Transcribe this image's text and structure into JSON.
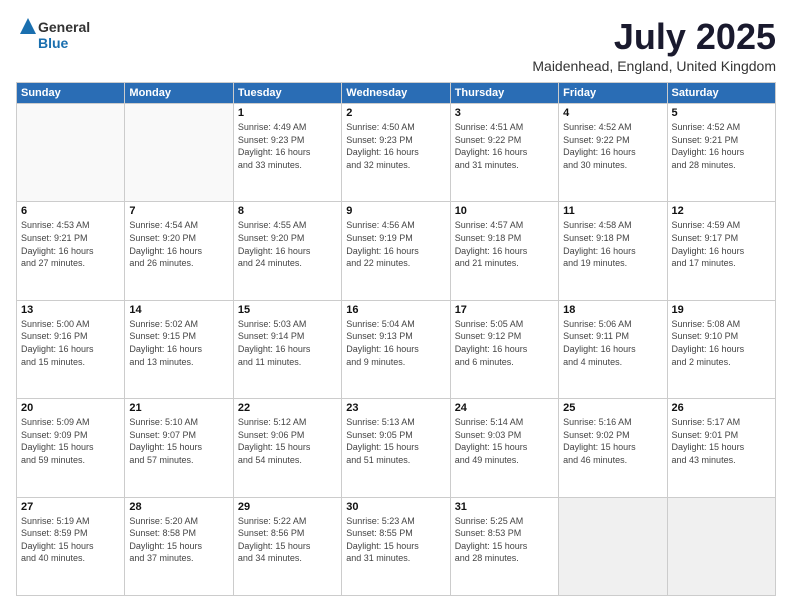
{
  "header": {
    "logo_general": "General",
    "logo_blue": "Blue",
    "month_title": "July 2025",
    "location": "Maidenhead, England, United Kingdom"
  },
  "days_of_week": [
    "Sunday",
    "Monday",
    "Tuesday",
    "Wednesday",
    "Thursday",
    "Friday",
    "Saturday"
  ],
  "weeks": [
    [
      {
        "day": "",
        "info": ""
      },
      {
        "day": "",
        "info": ""
      },
      {
        "day": "1",
        "info": "Sunrise: 4:49 AM\nSunset: 9:23 PM\nDaylight: 16 hours\nand 33 minutes."
      },
      {
        "day": "2",
        "info": "Sunrise: 4:50 AM\nSunset: 9:23 PM\nDaylight: 16 hours\nand 32 minutes."
      },
      {
        "day": "3",
        "info": "Sunrise: 4:51 AM\nSunset: 9:22 PM\nDaylight: 16 hours\nand 31 minutes."
      },
      {
        "day": "4",
        "info": "Sunrise: 4:52 AM\nSunset: 9:22 PM\nDaylight: 16 hours\nand 30 minutes."
      },
      {
        "day": "5",
        "info": "Sunrise: 4:52 AM\nSunset: 9:21 PM\nDaylight: 16 hours\nand 28 minutes."
      }
    ],
    [
      {
        "day": "6",
        "info": "Sunrise: 4:53 AM\nSunset: 9:21 PM\nDaylight: 16 hours\nand 27 minutes."
      },
      {
        "day": "7",
        "info": "Sunrise: 4:54 AM\nSunset: 9:20 PM\nDaylight: 16 hours\nand 26 minutes."
      },
      {
        "day": "8",
        "info": "Sunrise: 4:55 AM\nSunset: 9:20 PM\nDaylight: 16 hours\nand 24 minutes."
      },
      {
        "day": "9",
        "info": "Sunrise: 4:56 AM\nSunset: 9:19 PM\nDaylight: 16 hours\nand 22 minutes."
      },
      {
        "day": "10",
        "info": "Sunrise: 4:57 AM\nSunset: 9:18 PM\nDaylight: 16 hours\nand 21 minutes."
      },
      {
        "day": "11",
        "info": "Sunrise: 4:58 AM\nSunset: 9:18 PM\nDaylight: 16 hours\nand 19 minutes."
      },
      {
        "day": "12",
        "info": "Sunrise: 4:59 AM\nSunset: 9:17 PM\nDaylight: 16 hours\nand 17 minutes."
      }
    ],
    [
      {
        "day": "13",
        "info": "Sunrise: 5:00 AM\nSunset: 9:16 PM\nDaylight: 16 hours\nand 15 minutes."
      },
      {
        "day": "14",
        "info": "Sunrise: 5:02 AM\nSunset: 9:15 PM\nDaylight: 16 hours\nand 13 minutes."
      },
      {
        "day": "15",
        "info": "Sunrise: 5:03 AM\nSunset: 9:14 PM\nDaylight: 16 hours\nand 11 minutes."
      },
      {
        "day": "16",
        "info": "Sunrise: 5:04 AM\nSunset: 9:13 PM\nDaylight: 16 hours\nand 9 minutes."
      },
      {
        "day": "17",
        "info": "Sunrise: 5:05 AM\nSunset: 9:12 PM\nDaylight: 16 hours\nand 6 minutes."
      },
      {
        "day": "18",
        "info": "Sunrise: 5:06 AM\nSunset: 9:11 PM\nDaylight: 16 hours\nand 4 minutes."
      },
      {
        "day": "19",
        "info": "Sunrise: 5:08 AM\nSunset: 9:10 PM\nDaylight: 16 hours\nand 2 minutes."
      }
    ],
    [
      {
        "day": "20",
        "info": "Sunrise: 5:09 AM\nSunset: 9:09 PM\nDaylight: 15 hours\nand 59 minutes."
      },
      {
        "day": "21",
        "info": "Sunrise: 5:10 AM\nSunset: 9:07 PM\nDaylight: 15 hours\nand 57 minutes."
      },
      {
        "day": "22",
        "info": "Sunrise: 5:12 AM\nSunset: 9:06 PM\nDaylight: 15 hours\nand 54 minutes."
      },
      {
        "day": "23",
        "info": "Sunrise: 5:13 AM\nSunset: 9:05 PM\nDaylight: 15 hours\nand 51 minutes."
      },
      {
        "day": "24",
        "info": "Sunrise: 5:14 AM\nSunset: 9:03 PM\nDaylight: 15 hours\nand 49 minutes."
      },
      {
        "day": "25",
        "info": "Sunrise: 5:16 AM\nSunset: 9:02 PM\nDaylight: 15 hours\nand 46 minutes."
      },
      {
        "day": "26",
        "info": "Sunrise: 5:17 AM\nSunset: 9:01 PM\nDaylight: 15 hours\nand 43 minutes."
      }
    ],
    [
      {
        "day": "27",
        "info": "Sunrise: 5:19 AM\nSunset: 8:59 PM\nDaylight: 15 hours\nand 40 minutes."
      },
      {
        "day": "28",
        "info": "Sunrise: 5:20 AM\nSunset: 8:58 PM\nDaylight: 15 hours\nand 37 minutes."
      },
      {
        "day": "29",
        "info": "Sunrise: 5:22 AM\nSunset: 8:56 PM\nDaylight: 15 hours\nand 34 minutes."
      },
      {
        "day": "30",
        "info": "Sunrise: 5:23 AM\nSunset: 8:55 PM\nDaylight: 15 hours\nand 31 minutes."
      },
      {
        "day": "31",
        "info": "Sunrise: 5:25 AM\nSunset: 8:53 PM\nDaylight: 15 hours\nand 28 minutes."
      },
      {
        "day": "",
        "info": ""
      },
      {
        "day": "",
        "info": ""
      }
    ]
  ]
}
